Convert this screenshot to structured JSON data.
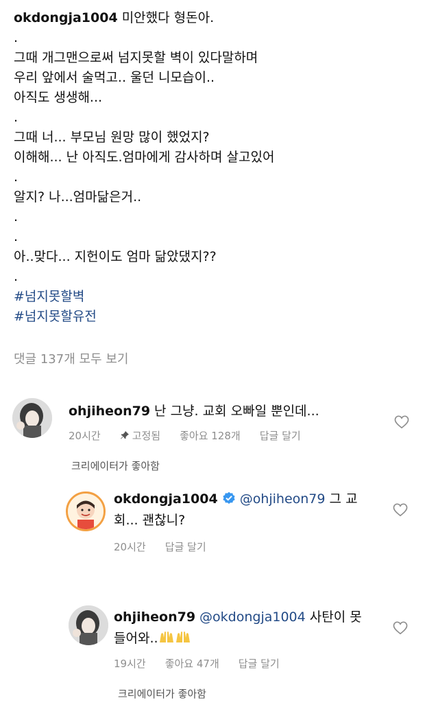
{
  "caption": {
    "username": "okdongja1004",
    "first_line": "미안했다 형돈아.",
    "lines": [
      ".",
      "그때 개그맨으로써 넘지못할 벽이 있다말하며",
      "우리 앞에서 술먹고.. 울던 니모습이..",
      "아직도 생생해...",
      ".",
      "그때 너... 부모님 원망 많이 했었지?",
      "이해해... 난 아직도.엄마에게 감사하며 살고있어",
      ".",
      "알지? 나...엄마닮은거..",
      ".",
      ".",
      "아..맞다... 지헌이도 엄마 닮았댔지??",
      "."
    ],
    "hashtags": [
      "#넘지못할벽",
      "#넘지못할유전"
    ]
  },
  "view_all": "댓글 137개 모두 보기",
  "comments": [
    {
      "username": "ohjiheon79",
      "text": "난 그냥.  교회 오빠일 뿐인데...",
      "time": "20시간",
      "pinned": "고정됨",
      "likes": "좋아요 128개",
      "reply": "답글 달기",
      "creator_liked": "크리에이터가 좋아함"
    },
    {
      "username": "okdongja1004",
      "mention": "@ohjiheon79",
      "text_line1": "그 교",
      "text_line2": "회... 괜찮니?",
      "time": "20시간",
      "reply": "답글 달기"
    },
    {
      "username": "ohjiheon79",
      "mention": "@okdongja1004",
      "text_line1": "사탄이 못",
      "text_line2": "들어와..",
      "time": "19시간",
      "likes": "좋아요 47개",
      "reply": "답글 달기",
      "creator_liked": "크리에이터가 좋아함"
    }
  ],
  "icons": {
    "heart": "heart-outline-icon",
    "pin": "pin-icon",
    "verified": "verified-badge-icon"
  },
  "colors": {
    "hashtag": "#224a86",
    "secondary_text": "#8e8e8e",
    "verified": "#3897f0"
  }
}
